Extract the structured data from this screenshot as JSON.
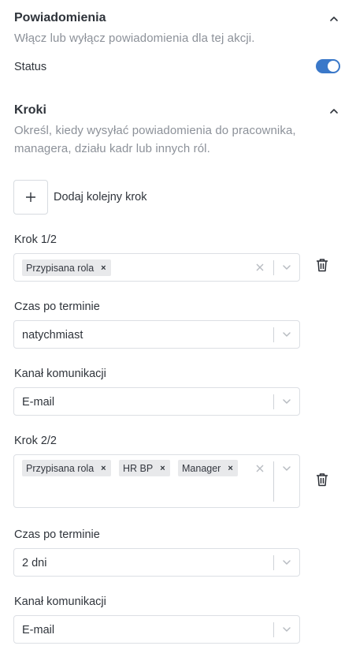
{
  "notifications": {
    "title": "Powiadomienia",
    "description": "Włącz lub wyłącz powiadomienia dla tej akcji.",
    "status_label": "Status",
    "status_on": true
  },
  "steps": {
    "title": "Kroki",
    "description_line1": "Określ, kiedy wysyłać powiadomienia do pracownika,",
    "description_line2": "managera, działu kadr lub innych ról.",
    "add_step_label": "Dodaj kolejny krok",
    "items": [
      {
        "title": "Krok 1/2",
        "roles": [
          "Przypisana rola"
        ],
        "time_label": "Czas po terminie",
        "time_value": "natychmiast",
        "channel_label": "Kanał komunikacji",
        "channel_value": "E-mail"
      },
      {
        "title": "Krok 2/2",
        "roles": [
          "Przypisana rola",
          "HR BP",
          "Manager"
        ],
        "time_label": "Czas po terminie",
        "time_value": "2 dni",
        "channel_label": "Kanał komunikacji",
        "channel_value": "E-mail"
      }
    ]
  },
  "icons": {
    "chip_remove": "×",
    "collapse": "chevron-up-icon",
    "dropdown": "chevron-down-icon",
    "clear": "close-icon",
    "delete": "trash-icon"
  },
  "colors": {
    "accent": "#3a78c9",
    "chip_bg": "#e8e9eb",
    "muted_text": "#8c9199",
    "border": "#dcdfe4"
  }
}
